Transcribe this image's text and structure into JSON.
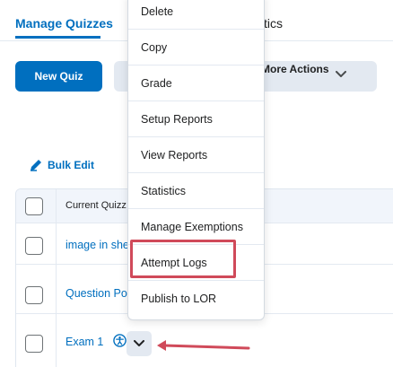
{
  "tabs": {
    "manage": "Manage Quizzes",
    "stats_partial": "stics"
  },
  "toolbar": {
    "new_quiz": "New Quiz",
    "more_actions": "More Actions"
  },
  "bulk_edit": "Bulk Edit",
  "table": {
    "header": "Current Quizz",
    "rows": [
      {
        "name": "image in she"
      },
      {
        "name": "Question Po"
      },
      {
        "name": "Exam 1"
      }
    ]
  },
  "context_menu": {
    "items": [
      "Delete",
      "Copy",
      "Grade",
      "Setup Reports",
      "View Reports",
      "Statistics",
      "Manage Exemptions",
      "Attempt Logs",
      "Publish to LOR"
    ],
    "highlighted": "Attempt Logs"
  },
  "colors": {
    "accent": "#006fbf",
    "highlight": "#d04a5a",
    "arrow": "#d04a5a"
  }
}
